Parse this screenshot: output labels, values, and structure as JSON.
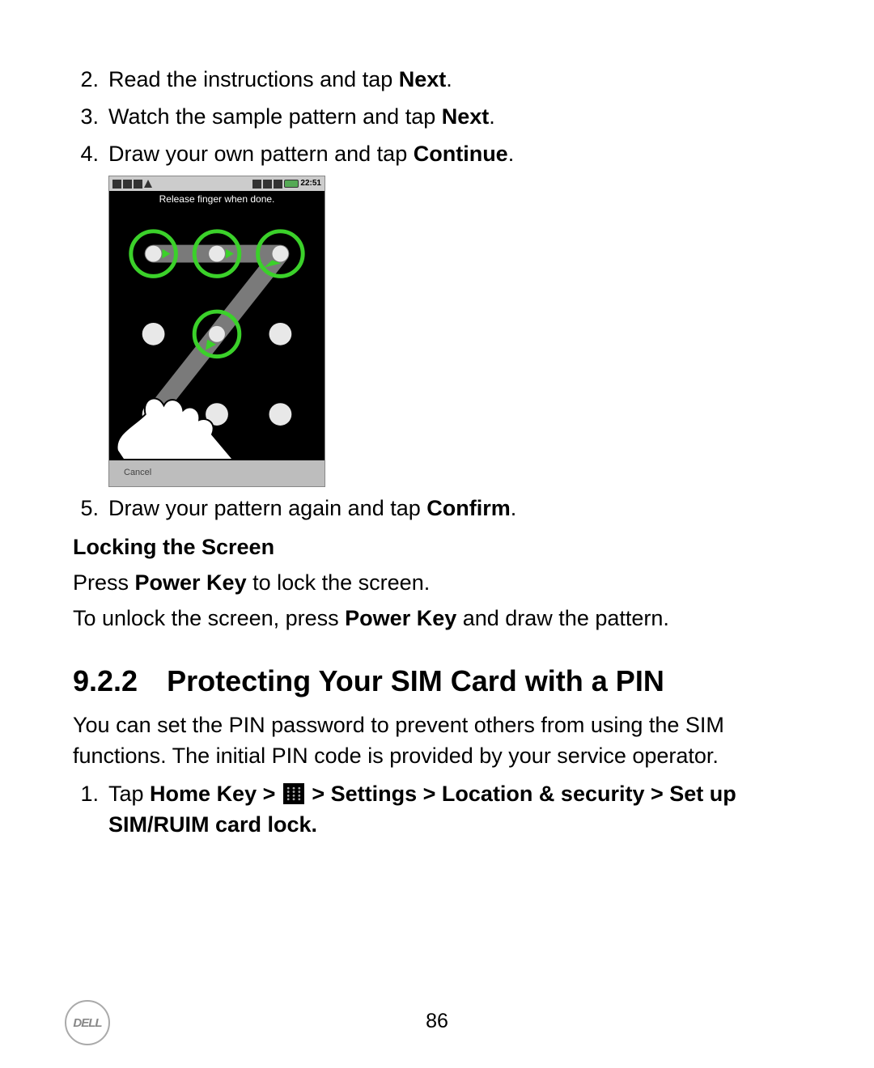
{
  "steps_a": [
    {
      "n": "2.",
      "pre": "Read the instructions and tap ",
      "b": "Next",
      "post": "."
    },
    {
      "n": "3.",
      "pre": "Watch the sample pattern and tap ",
      "b": "Next",
      "post": "."
    },
    {
      "n": "4.",
      "pre": "Draw your own pattern and tap ",
      "b": "Continue",
      "post": "."
    }
  ],
  "phone": {
    "time": "22:51",
    "hint": "Release finger when done.",
    "cancel": "Cancel"
  },
  "steps_b": [
    {
      "n": "5.",
      "pre": "Draw your pattern again and tap ",
      "b": "Confirm",
      "post": "."
    }
  ],
  "subhead": "Locking the Screen",
  "lock_p1": {
    "pre": "Press ",
    "b": "Power Key",
    "post": " to lock the screen."
  },
  "lock_p2": {
    "pre": "To unlock the screen, press ",
    "b": "Power Key",
    "post": " and draw the pattern."
  },
  "section": {
    "num": "9.2.2",
    "title": "Protecting Your SIM Card with a PIN"
  },
  "section_intro": "You can set the PIN password to prevent others from using the SIM functions. The initial PIN code is provided by your service operator.",
  "pin_step": {
    "n": "1.",
    "pre": "Tap ",
    "b1": "Home Key > ",
    "b2": " > Settings > Location & security > Set up SIM/RUIM card lock."
  },
  "page_number": "86",
  "logo": "DELL"
}
